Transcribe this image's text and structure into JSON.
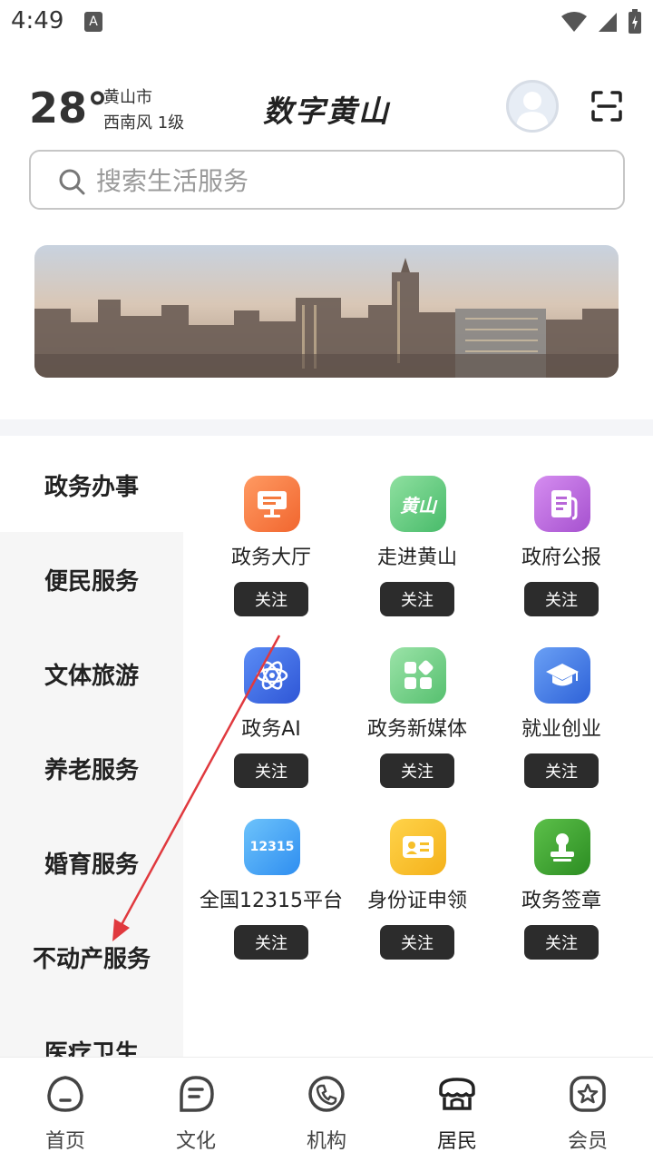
{
  "status_bar": {
    "time": "4:49",
    "notification_glyph": "A"
  },
  "weather": {
    "temperature": "28°",
    "city": "黄山市",
    "wind": "西南风  1级"
  },
  "header": {
    "title": "数字黄山"
  },
  "search": {
    "placeholder": "搜索生活服务"
  },
  "categories": [
    {
      "label": "政务办事",
      "active": true
    },
    {
      "label": "便民服务",
      "active": false
    },
    {
      "label": "文体旅游",
      "active": false
    },
    {
      "label": "养老服务",
      "active": false
    },
    {
      "label": "婚育服务",
      "active": false
    },
    {
      "label": "不动产服务",
      "active": false
    },
    {
      "label": "医疗卫生",
      "active": false
    }
  ],
  "services": [
    {
      "label": "政务大厅",
      "follow": "关注",
      "icon": "monitor-icon",
      "color": "#f47a3e"
    },
    {
      "label": "走进黄山",
      "follow": "关注",
      "icon": "huangshan-logo-icon",
      "icon_text": "黄山",
      "color": "#5bc879"
    },
    {
      "label": "政府公报",
      "follow": "关注",
      "icon": "document-icon",
      "color": "#b867d8"
    },
    {
      "label": "政务AI",
      "follow": "关注",
      "icon": "atom-icon",
      "color": "#3d6ee8"
    },
    {
      "label": "政务新媒体",
      "follow": "关注",
      "icon": "apps-grid-icon",
      "color": "#6fcf83"
    },
    {
      "label": "就业创业",
      "follow": "关注",
      "icon": "graduation-cap-icon",
      "color": "#3e79e6"
    },
    {
      "label": "全国12315平台",
      "follow": "关注",
      "icon": "hotline-12315-icon",
      "icon_text": "12315",
      "color": "#45a7f3"
    },
    {
      "label": "身份证申领",
      "follow": "关注",
      "icon": "id-card-icon",
      "color": "#f6bf2a"
    },
    {
      "label": "政务签章",
      "follow": "关注",
      "icon": "stamp-icon",
      "color": "#3aa12e"
    }
  ],
  "bottom_nav": [
    {
      "label": "首页",
      "icon": "home-icon"
    },
    {
      "label": "文化",
      "icon": "culture-icon"
    },
    {
      "label": "机构",
      "icon": "phone-icon"
    },
    {
      "label": "居民",
      "icon": "resident-icon",
      "active": true
    },
    {
      "label": "会员",
      "icon": "member-star-icon"
    }
  ],
  "colors": {
    "follow_button": "#2c2c2c",
    "annotation_arrow": "#e0393e"
  }
}
